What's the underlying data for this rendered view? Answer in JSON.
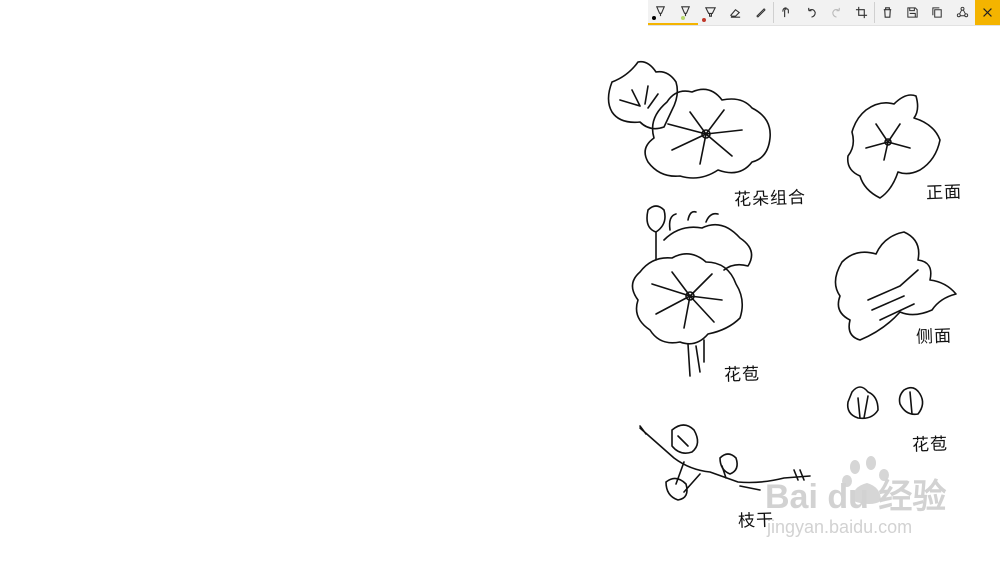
{
  "toolbar": {
    "tools": [
      {
        "name": "ballpoint-pen",
        "ink": "#000000"
      },
      {
        "name": "pencil",
        "ink": "#b8d86b"
      },
      {
        "name": "highlighter",
        "ink": "#c0392b"
      }
    ],
    "accent_color": "#f4b400",
    "close_background": "#f4b400"
  },
  "captions": {
    "flower_combo": "花朵组合",
    "front": "正面",
    "flower_buds_cluster": "花苞",
    "side": "侧面",
    "bud": "花苞",
    "branch": "枝干"
  },
  "watermark": {
    "brand": "Bai du 经验",
    "url": "jingyan.baidu.com"
  }
}
